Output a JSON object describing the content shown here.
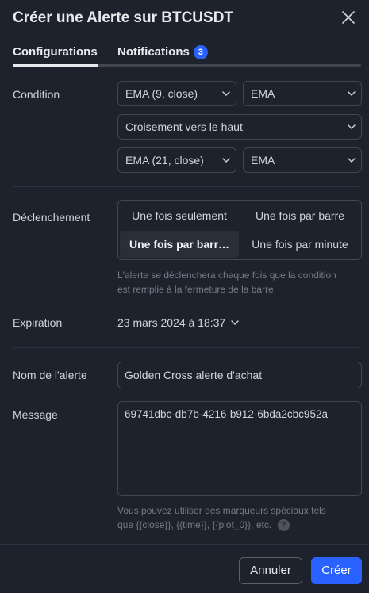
{
  "header": {
    "title": "Créer une Alerte sur BTCUSDT",
    "close_icon": "close-icon"
  },
  "tabs": [
    {
      "label": "Configurations",
      "active": true
    },
    {
      "label": "Notifications",
      "badge": "3"
    }
  ],
  "condition": {
    "label": "Condition",
    "indicator_1": "EMA (9, close)",
    "source_1": "EMA",
    "operator": "Croisement vers le haut",
    "indicator_2": "EMA (21, close)",
    "source_2": "EMA"
  },
  "trigger": {
    "label": "Déclenchement",
    "options": [
      "Une fois seulement",
      "Une fois par barre",
      "Une fois par barr…",
      "Une fois par minute"
    ],
    "selected": "Une fois par barr…",
    "hint_line1": "L'alerte se déclenchera chaque fois que la condition",
    "hint_line2": "est remplie à la fermeture de la barre"
  },
  "expiration": {
    "label": "Expiration",
    "value": "23 mars 2024 à 18:37"
  },
  "alert_name": {
    "label": "Nom de l'alerte",
    "value": "Golden Cross alerte d'achat"
  },
  "message": {
    "label": "Message",
    "value": "69741dbc-db7b-4216-b912-6bda2cbc952a",
    "hint_line1": "Vous pouvez utiliser des marqueurs spéciaux tels",
    "hint_line2": "que {{close}}, {{time}}, {{plot_0}}, etc.",
    "help_glyph": "?"
  },
  "footer": {
    "cancel_label": "Annuler",
    "create_label": "Créer"
  },
  "colors": {
    "background": "#1e222d",
    "accent": "#2962ff",
    "border": "#434651",
    "muted": "#787b86"
  }
}
